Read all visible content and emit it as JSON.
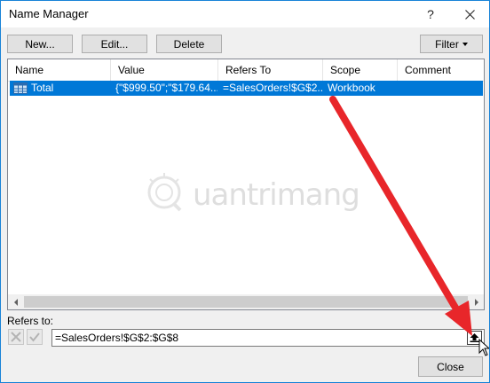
{
  "window": {
    "title": "Name Manager",
    "help_label": "?"
  },
  "toolbar": {
    "new_label": "New...",
    "edit_label": "Edit...",
    "delete_label": "Delete",
    "filter_label": "Filter"
  },
  "list": {
    "columns": [
      "Name",
      "Value",
      "Refers To",
      "Scope",
      "Comment"
    ],
    "rows": [
      {
        "icon": "table-icon",
        "name": "Total",
        "value": "{\"$999.50\";\"$179.64...",
        "refers_to": "=SalesOrders!$G$2...",
        "scope": "Workbook",
        "comment": ""
      }
    ],
    "selected_row_color": "#0078d7"
  },
  "refers": {
    "label": "Refers to:",
    "value": "=SalesOrders!$G$2:$G$8"
  },
  "footer": {
    "close_label": "Close"
  },
  "watermark": {
    "text": "uantrimang"
  },
  "annotation": {
    "arrow_color": "#e8262a"
  }
}
